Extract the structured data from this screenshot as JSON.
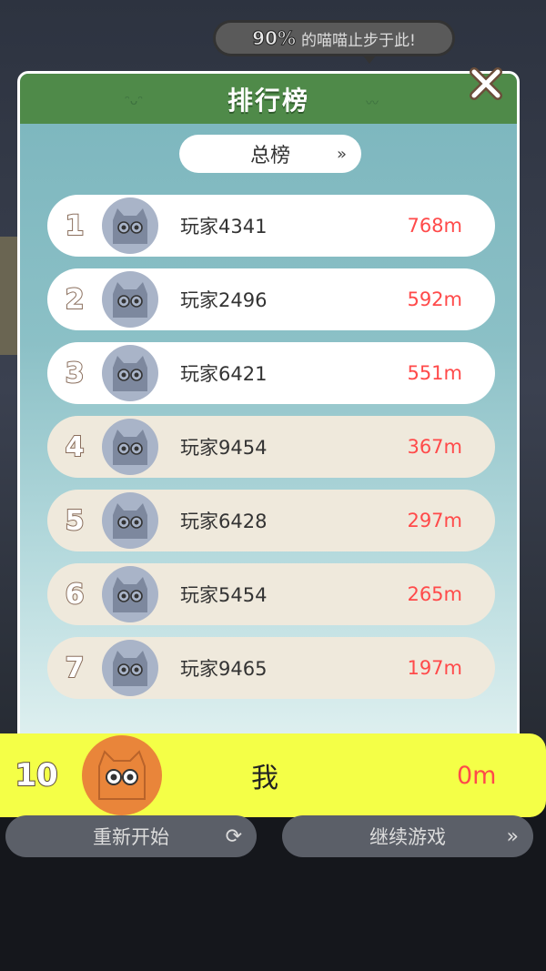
{
  "hint": {
    "percent": "90%",
    "text": "的喵喵止步于此!"
  },
  "panel": {
    "title": "排行榜",
    "tab_label": "总榜"
  },
  "leaderboard": [
    {
      "rank": "1",
      "name": "玩家4341",
      "score": "768m"
    },
    {
      "rank": "2",
      "name": "玩家2496",
      "score": "592m"
    },
    {
      "rank": "3",
      "name": "玩家6421",
      "score": "551m"
    },
    {
      "rank": "4",
      "name": "玩家9454",
      "score": "367m"
    },
    {
      "rank": "5",
      "name": "玩家6428",
      "score": "297m"
    },
    {
      "rank": "6",
      "name": "玩家5454",
      "score": "265m"
    },
    {
      "rank": "7",
      "name": "玩家9465",
      "score": "197m"
    }
  ],
  "me": {
    "rank": "10",
    "name": "我",
    "score": "0m"
  },
  "buttons": {
    "restart": "重新开始",
    "continue": "继续游戏"
  },
  "colors": {
    "header_green": "#4f8a49",
    "score_red": "#ff4a4a",
    "self_highlight": "#f4ff47",
    "cat_orange": "#e9853a",
    "cat_gray": "#a9b4c8"
  }
}
